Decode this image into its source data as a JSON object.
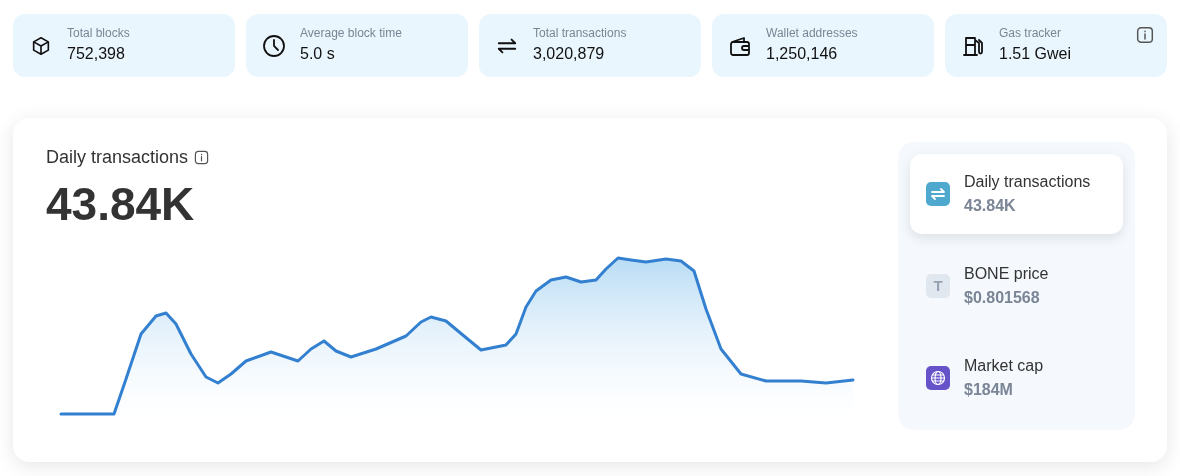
{
  "stats": [
    {
      "kind": "blocks",
      "label": "Total blocks",
      "value": "752,398",
      "info": false
    },
    {
      "kind": "time",
      "label": "Average block time",
      "value": "5.0 s",
      "info": false
    },
    {
      "kind": "transfers",
      "label": "Total transactions",
      "value": "3,020,879",
      "info": false
    },
    {
      "kind": "wallet",
      "label": "Wallet addresses",
      "value": "1,250,146",
      "info": false
    },
    {
      "kind": "gas",
      "label": "Gas tracker",
      "value": "1.51 Gwei",
      "info": true
    }
  ],
  "chart_panel": {
    "title": "Daily transactions",
    "info": true,
    "value": "43.84K"
  },
  "metrics": [
    {
      "kind": "transfers",
      "label": "Daily transactions",
      "value": "43.84K",
      "selected": true
    },
    {
      "kind": "token",
      "symbol": "T",
      "label": "BONE price",
      "value": "$0.801568",
      "selected": false
    },
    {
      "kind": "globe",
      "label": "Market cap",
      "value": "$184M",
      "selected": false
    }
  ]
}
